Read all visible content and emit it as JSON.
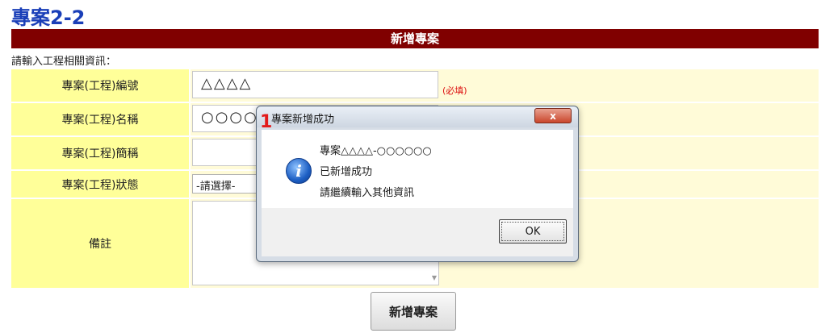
{
  "page_title": "專案2-2",
  "section_header": "新增專案",
  "instruction": "請輸入工程相關資訊：",
  "form": {
    "project_id": {
      "label": "專案(工程)編號",
      "value": "△△△△",
      "required_note": "(必填)"
    },
    "project_name": {
      "label": "專案(工程)名稱",
      "value": "○○○○"
    },
    "project_short_name": {
      "label": "專案(工程)簡稱",
      "value": ""
    },
    "project_status": {
      "label": "專案(工程)狀態",
      "selected": "-請選擇-"
    },
    "remarks": {
      "label": "備註",
      "value": ""
    }
  },
  "submit_label": "新增專案",
  "dialog": {
    "title": "專案新增成功",
    "close_label": "x",
    "icon": "info-icon",
    "message_lines": [
      "專案△△△△-○○○○○○",
      "已新增成功",
      "請繼續輸入其他資訊"
    ],
    "ok_label": "OK"
  },
  "annotation_marker": "1",
  "colors": {
    "title": "#1a3fb8",
    "header_bg": "#800000",
    "label_bg": "#ffff99",
    "value_bg": "#fffbd8",
    "required": "#dd1111",
    "annotation": "#e21a1a"
  }
}
